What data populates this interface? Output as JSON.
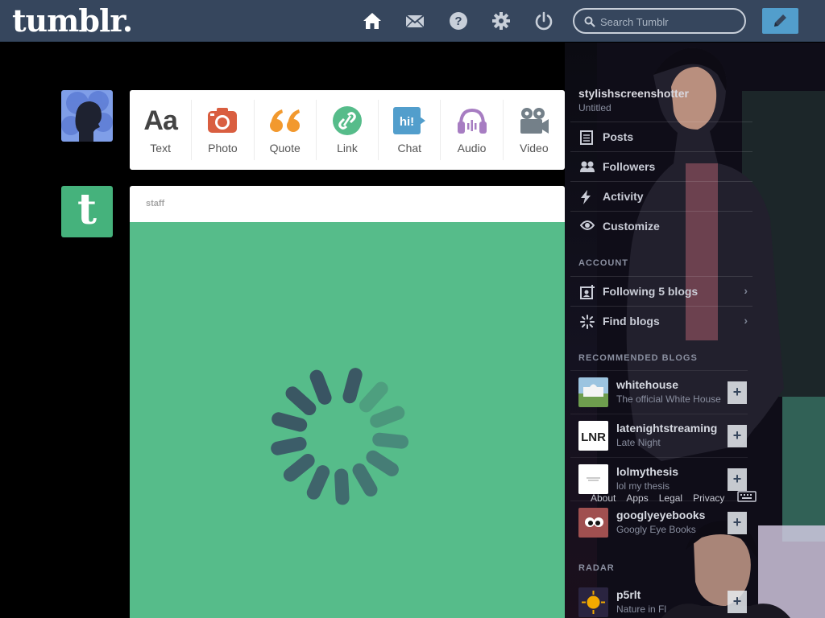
{
  "header": {
    "logo": "tumblr.",
    "search_placeholder": "Search Tumblr",
    "colors": {
      "bar": "#36465d",
      "compose": "#529ecc"
    },
    "nav_icons": [
      "home-icon",
      "mail-icon",
      "help-icon",
      "settings-icon",
      "power-icon"
    ]
  },
  "post_types": [
    {
      "label": "Text",
      "icon": "text-icon",
      "color": "#444444"
    },
    {
      "label": "Photo",
      "icon": "camera-icon",
      "color": "#d95e40"
    },
    {
      "label": "Quote",
      "icon": "quote-icon",
      "color": "#f2992e"
    },
    {
      "label": "Link",
      "icon": "link-icon",
      "color": "#56bc8a"
    },
    {
      "label": "Chat",
      "icon": "chat-icon",
      "color": "#529ecc"
    },
    {
      "label": "Audio",
      "icon": "headphones-icon",
      "color": "#a77dc2"
    },
    {
      "label": "Video",
      "icon": "video-camera-icon",
      "color": "#748089"
    }
  ],
  "post": {
    "author": "staff",
    "media_color": "#56bc8a"
  },
  "sidebar": {
    "blog_name": "stylishscreenshotter",
    "blog_title": "Untitled",
    "menu": [
      {
        "label": "Posts",
        "icon": "document-icon"
      },
      {
        "label": "Followers",
        "icon": "people-icon"
      },
      {
        "label": "Activity",
        "icon": "lightning-icon"
      },
      {
        "label": "Customize",
        "icon": "eye-icon"
      }
    ],
    "account_label": "ACCOUNT",
    "account_menu": [
      {
        "label": "Following 5 blogs",
        "icon": "person-add-icon"
      },
      {
        "label": "Find blogs",
        "icon": "sparkle-icon"
      }
    ],
    "recommended_label": "RECOMMENDED BLOGS",
    "recommended": [
      {
        "name": "whitehouse",
        "desc": "The official White House",
        "thumb_color": "#8fb86a"
      },
      {
        "name": "latenightstreaming",
        "desc": "Late Night",
        "thumb_color": "#ffffff"
      },
      {
        "name": "lolmythesis",
        "desc": "lol my thesis",
        "thumb_color": "#ffffff"
      },
      {
        "name": "googlyeyebooks",
        "desc": "Googly Eye Books",
        "thumb_color": "#a05050"
      }
    ],
    "radar_label": "RADAR",
    "radar": {
      "name": "p5rlt",
      "desc": "Nature in Fl",
      "thumb_color": "#2a2440"
    },
    "footer_links": [
      "About",
      "Apps",
      "Legal",
      "Privacy"
    ]
  }
}
